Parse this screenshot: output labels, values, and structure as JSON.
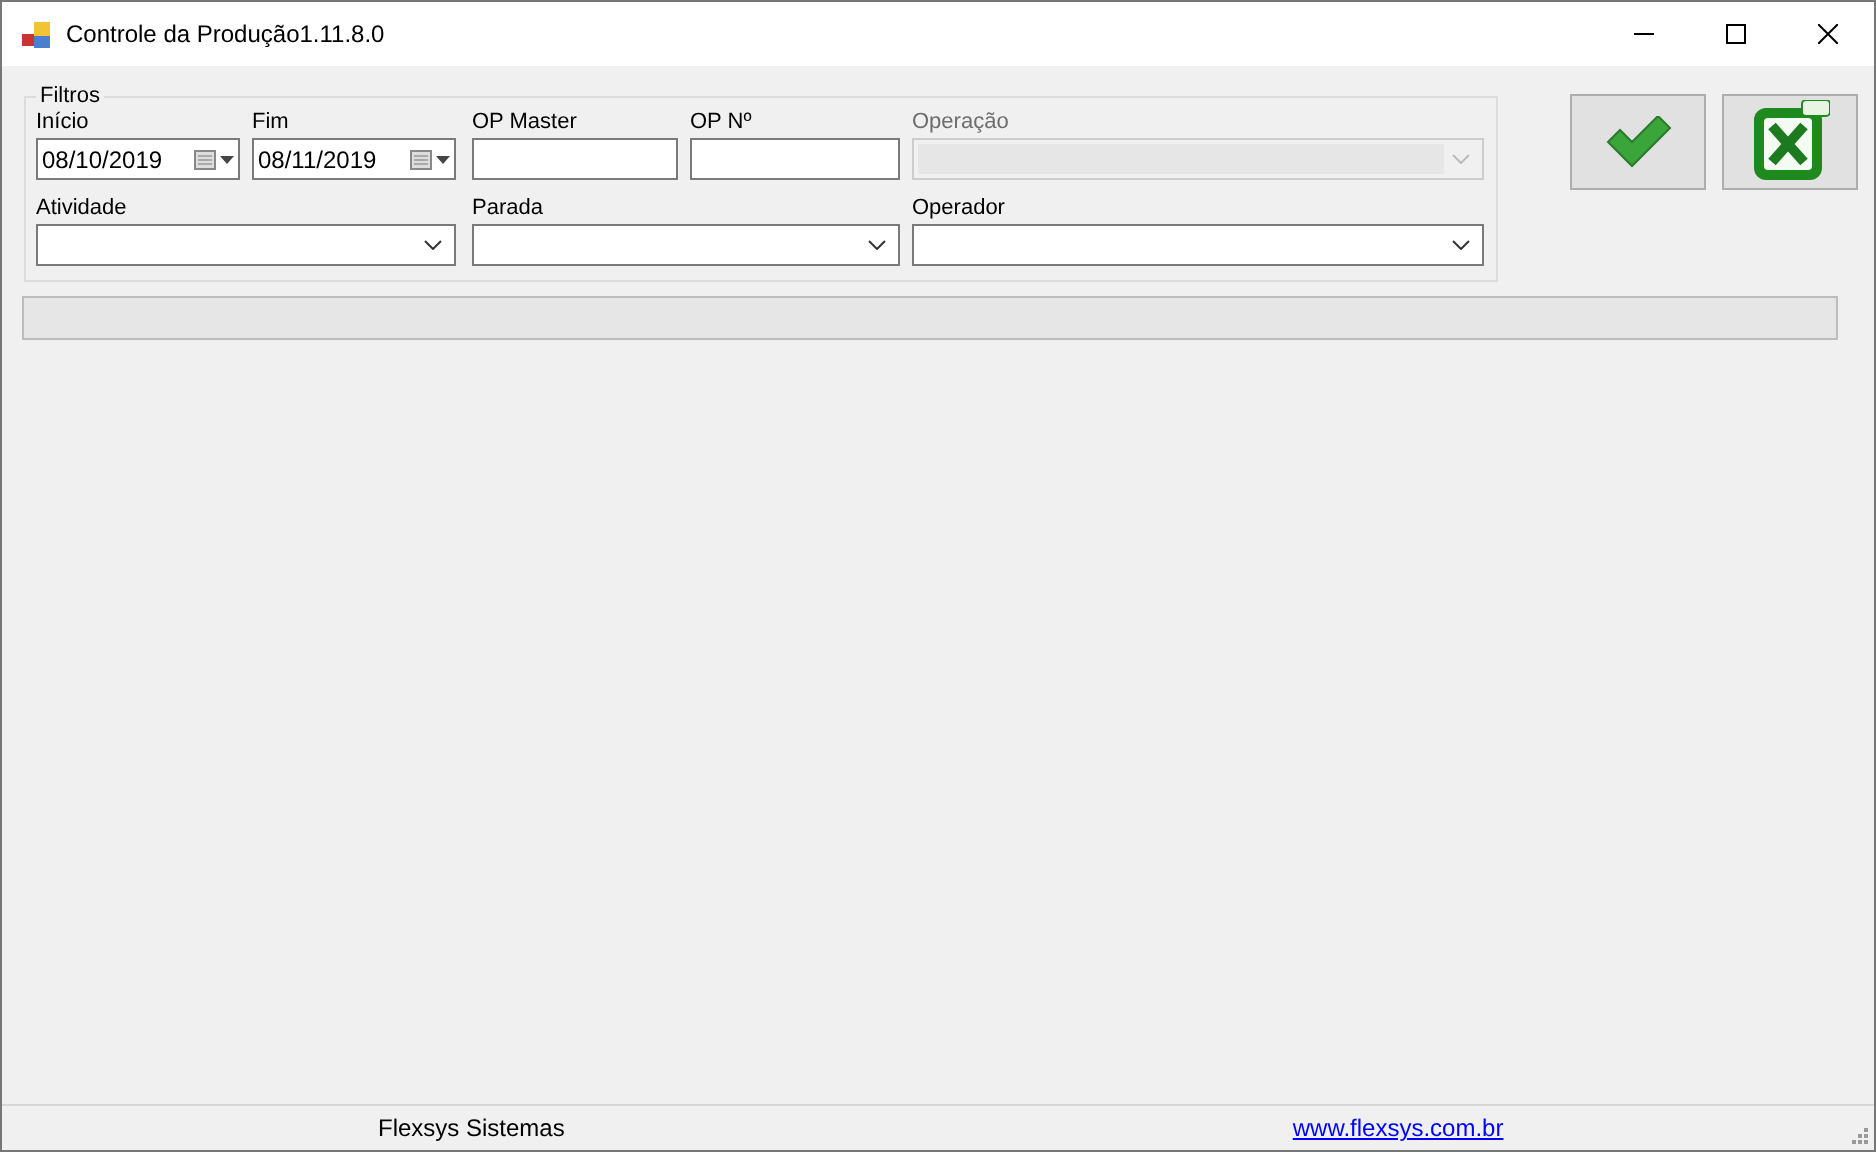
{
  "window": {
    "title": "Controle da Produção1.11.8.0"
  },
  "filters": {
    "title": "Filtros",
    "fields": [
      {
        "label": "Início",
        "kind": "date",
        "value": "08/10/2019",
        "disabled": false
      },
      {
        "label": "Fim",
        "kind": "date",
        "value": "08/11/2019",
        "disabled": false
      },
      {
        "label": "OP Master",
        "kind": "text",
        "disabled": false
      },
      {
        "label": "OP Nº",
        "kind": "text",
        "disabled": false
      },
      {
        "label": "Operação",
        "kind": "combo",
        "disabled": true
      },
      {
        "label": "Atividade",
        "kind": "combo",
        "disabled": false
      },
      {
        "label": "Parada",
        "kind": "combo",
        "disabled": false
      },
      {
        "label": "Operador",
        "kind": "combo",
        "disabled": false
      }
    ]
  },
  "progress": {
    "level": 0
  },
  "status_bar": {
    "company": "Flexsys Sistemas",
    "link": "www.flexsys.com.br"
  }
}
